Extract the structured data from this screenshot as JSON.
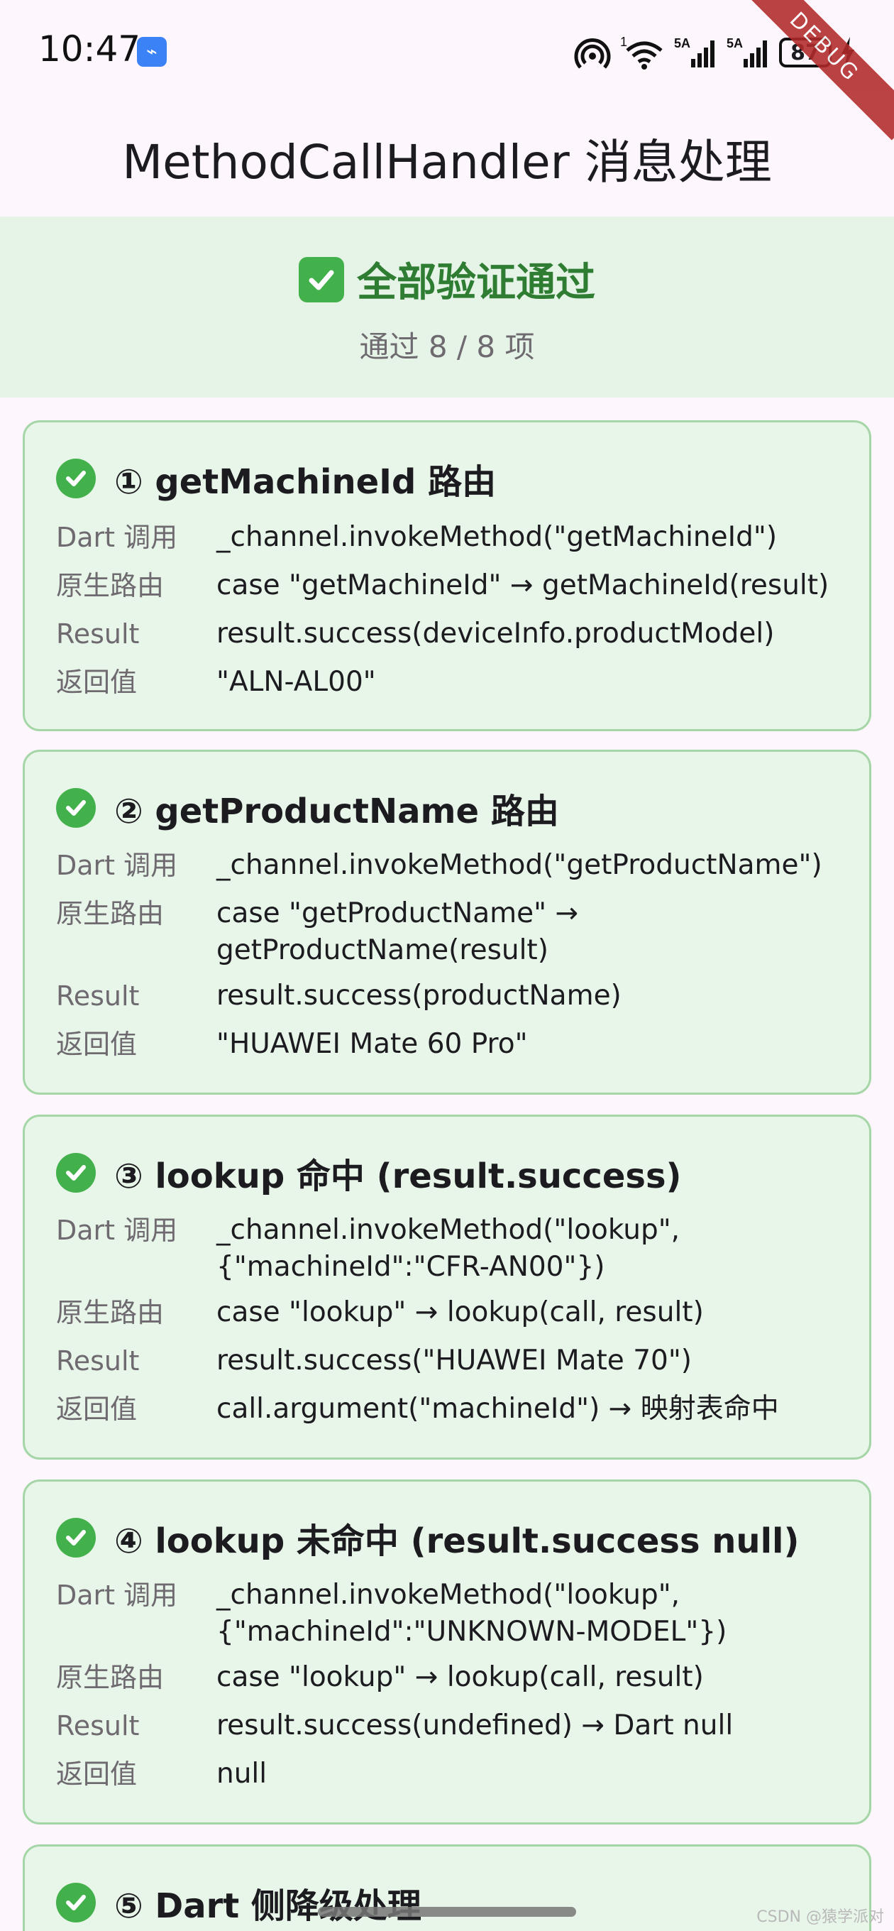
{
  "status_bar": {
    "time": "10:47",
    "battery": "87",
    "signal_labels": [
      "1",
      "5A",
      "5A"
    ]
  },
  "debug_ribbon": "DEBUG",
  "app_bar": {
    "title": "MethodCallHandler 消息处理"
  },
  "summary": {
    "title": "全部验证通过",
    "subtitle": "通过 8 / 8 项",
    "accent_color": "#2e7d32"
  },
  "cards": [
    {
      "title": "① getMachineId 路由",
      "rows": [
        {
          "label": "Dart 调用",
          "lines": [
            "_channel.invokeMethod(\"getMachineId\")"
          ]
        },
        {
          "label": "原生路由",
          "lines": [
            "case \"getMachineId\" → getMachineId(result)"
          ]
        },
        {
          "label": "Result",
          "lines": [
            "result.success(deviceInfo.productModel)"
          ]
        },
        {
          "label": "返回值",
          "lines": [
            "\"ALN-AL00\""
          ]
        }
      ]
    },
    {
      "title": "② getProductName 路由",
      "rows": [
        {
          "label": "Dart 调用",
          "lines": [
            "_channel.invokeMethod(\"getProductName\")"
          ]
        },
        {
          "label": "原生路由",
          "lines": [
            "case \"getProductName\" →",
            "getProductName(result)"
          ]
        },
        {
          "label": "Result",
          "lines": [
            "result.success(productName)"
          ]
        },
        {
          "label": "返回值",
          "lines": [
            "\"HUAWEI Mate 60 Pro\""
          ]
        }
      ]
    },
    {
      "title": "③ lookup 命中 (result.success)",
      "rows": [
        {
          "label": "Dart 调用",
          "lines": [
            "_channel.invokeMethod(\"lookup\",",
            "{\"machineId\":\"CFR-AN00\"})"
          ]
        },
        {
          "label": "原生路由",
          "lines": [
            "case \"lookup\" → lookup(call, result)"
          ]
        },
        {
          "label": "Result",
          "lines": [
            "result.success(\"HUAWEI Mate 70\")"
          ]
        },
        {
          "label": "返回值",
          "lines": [
            "call.argument(\"machineId\") → 映射表命中"
          ]
        }
      ]
    },
    {
      "title": "④ lookup 未命中 (result.success null)",
      "rows": [
        {
          "label": "Dart 调用",
          "lines": [
            "_channel.invokeMethod(\"lookup\",",
            "{\"machineId\":\"UNKNOWN-MODEL\"})"
          ]
        },
        {
          "label": "原生路由",
          "lines": [
            "case \"lookup\" → lookup(call, result)"
          ]
        },
        {
          "label": "Result",
          "lines": [
            "result.success(undefined) → Dart null"
          ]
        },
        {
          "label": "返回值",
          "lines": [
            "null"
          ]
        }
      ]
    },
    {
      "title": "⑤ Dart 侧降级处理",
      "rows": []
    }
  ],
  "watermark": "CSDN @猿学派对"
}
